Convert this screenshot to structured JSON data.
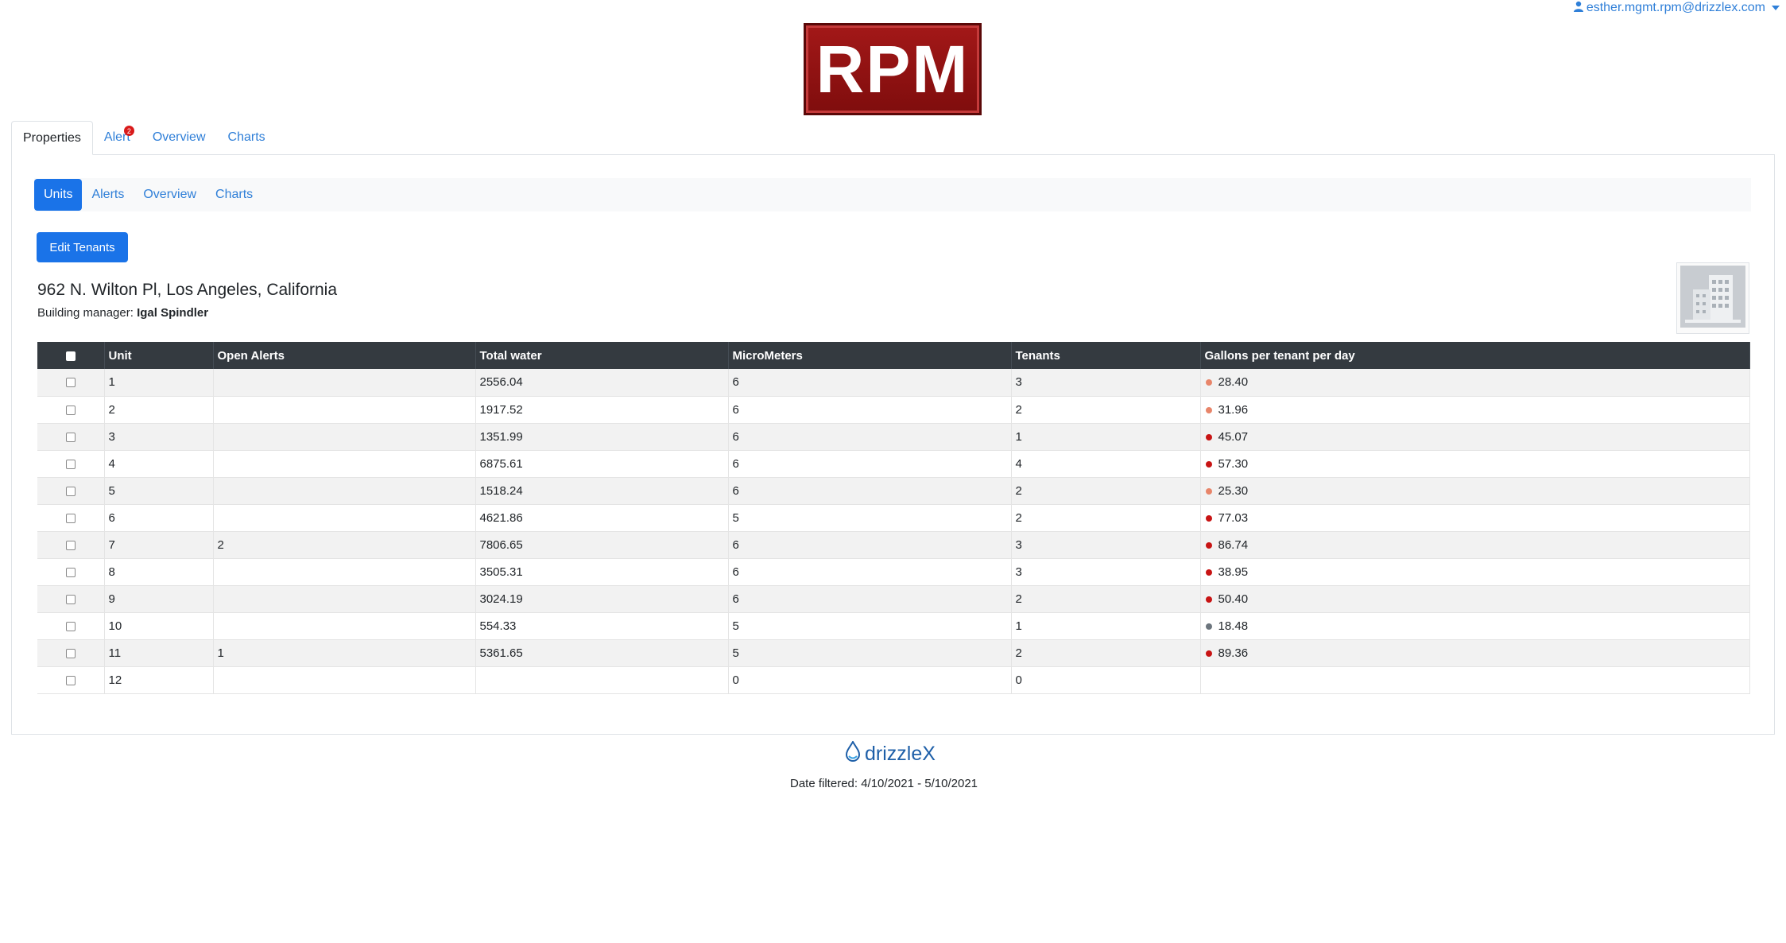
{
  "user": {
    "email": "esther.mgmt.rpm@drizzlex.com",
    "icon": "user-icon"
  },
  "logo": {
    "text": "RPM"
  },
  "top_tabs": [
    {
      "label": "Properties",
      "active": true
    },
    {
      "label": "Alert",
      "badge": "2"
    },
    {
      "label": "Overview"
    },
    {
      "label": "Charts"
    }
  ],
  "sub_tabs": [
    {
      "label": "Units",
      "active": true
    },
    {
      "label": "Alerts"
    },
    {
      "label": "Overview"
    },
    {
      "label": "Charts"
    }
  ],
  "edit_button": "Edit Tenants",
  "property": {
    "address": "962 N. Wilton Pl, Los Angeles, California",
    "manager_label": "Building manager:",
    "manager_name": "Igal Spindler",
    "image_icon": "building-icon"
  },
  "table": {
    "headers": [
      "Unit",
      "Open Alerts",
      "Total water",
      "MicroMeters",
      "Tenants",
      "Gallons per tenant per day"
    ],
    "rows": [
      {
        "unit": "1",
        "open_alerts": "",
        "total_water": "2556.04",
        "micrometers": "6",
        "tenants": "3",
        "gallons": "28.40",
        "status": "#e8856a"
      },
      {
        "unit": "2",
        "open_alerts": "",
        "total_water": "1917.52",
        "micrometers": "6",
        "tenants": "2",
        "gallons": "31.96",
        "status": "#e8856a"
      },
      {
        "unit": "3",
        "open_alerts": "",
        "total_water": "1351.99",
        "micrometers": "6",
        "tenants": "1",
        "gallons": "45.07",
        "status": "#c81414"
      },
      {
        "unit": "4",
        "open_alerts": "",
        "total_water": "6875.61",
        "micrometers": "6",
        "tenants": "4",
        "gallons": "57.30",
        "status": "#c81414"
      },
      {
        "unit": "5",
        "open_alerts": "",
        "total_water": "1518.24",
        "micrometers": "6",
        "tenants": "2",
        "gallons": "25.30",
        "status": "#e8856a"
      },
      {
        "unit": "6",
        "open_alerts": "",
        "total_water": "4621.86",
        "micrometers": "5",
        "tenants": "2",
        "gallons": "77.03",
        "status": "#c81414"
      },
      {
        "unit": "7",
        "open_alerts": "2",
        "total_water": "7806.65",
        "micrometers": "6",
        "tenants": "3",
        "gallons": "86.74",
        "status": "#c81414"
      },
      {
        "unit": "8",
        "open_alerts": "",
        "total_water": "3505.31",
        "micrometers": "6",
        "tenants": "3",
        "gallons": "38.95",
        "status": "#c81414"
      },
      {
        "unit": "9",
        "open_alerts": "",
        "total_water": "3024.19",
        "micrometers": "6",
        "tenants": "2",
        "gallons": "50.40",
        "status": "#c81414"
      },
      {
        "unit": "10",
        "open_alerts": "",
        "total_water": "554.33",
        "micrometers": "5",
        "tenants": "1",
        "gallons": "18.48",
        "status": "#6c757d"
      },
      {
        "unit": "11",
        "open_alerts": "1",
        "total_water": "5361.65",
        "micrometers": "5",
        "tenants": "2",
        "gallons": "89.36",
        "status": "#c81414"
      },
      {
        "unit": "12",
        "open_alerts": "",
        "total_water": "",
        "micrometers": "0",
        "tenants": "0",
        "gallons": "",
        "status": ""
      }
    ]
  },
  "footer": {
    "brand": "drizzleX",
    "date_filtered": "Date filtered: 4/10/2021 - 5/10/2021",
    "brand_icon": "water-drop-icon"
  }
}
